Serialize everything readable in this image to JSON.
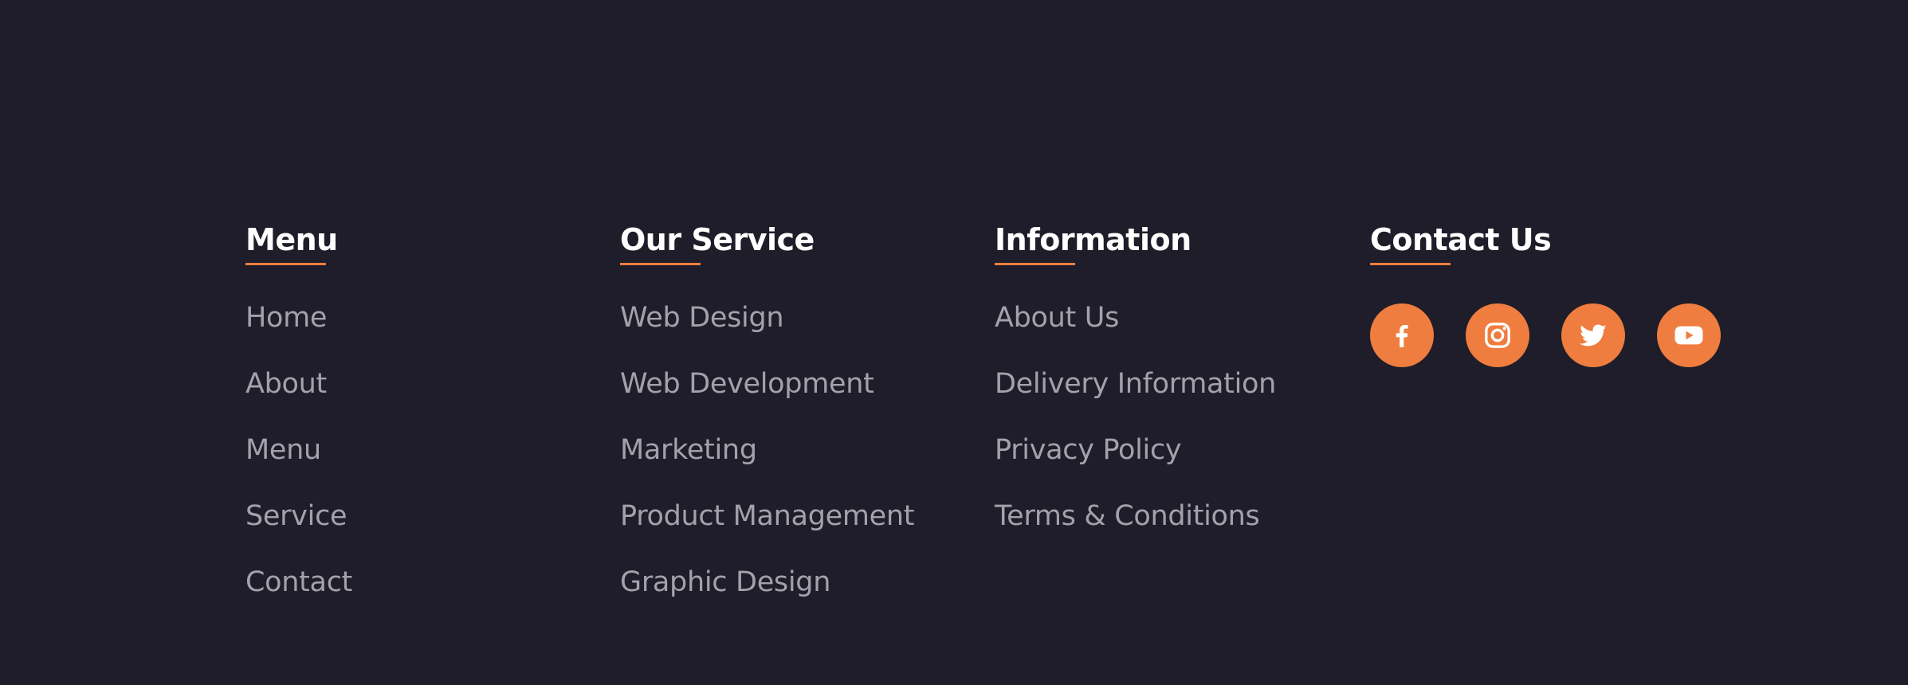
{
  "footer": {
    "colors": {
      "background": "#1f1d29",
      "accent": "#ef7d3f",
      "heading": "#ffffff",
      "link": "#a3a1ab"
    },
    "menu": {
      "title": "Menu",
      "items": [
        "Home",
        "About",
        "Menu",
        "Service",
        "Contact"
      ]
    },
    "service": {
      "title": "Our Service",
      "items": [
        "Web Design",
        "Web Development",
        "Marketing",
        "Product Management",
        "Graphic Design"
      ]
    },
    "information": {
      "title": "Information",
      "items": [
        "About Us",
        "Delivery Information",
        "Privacy Policy",
        "Terms & Conditions"
      ]
    },
    "contact": {
      "title": "Contact Us",
      "socials": [
        "facebook-icon",
        "instagram-icon",
        "twitter-icon",
        "youtube-icon"
      ]
    }
  }
}
